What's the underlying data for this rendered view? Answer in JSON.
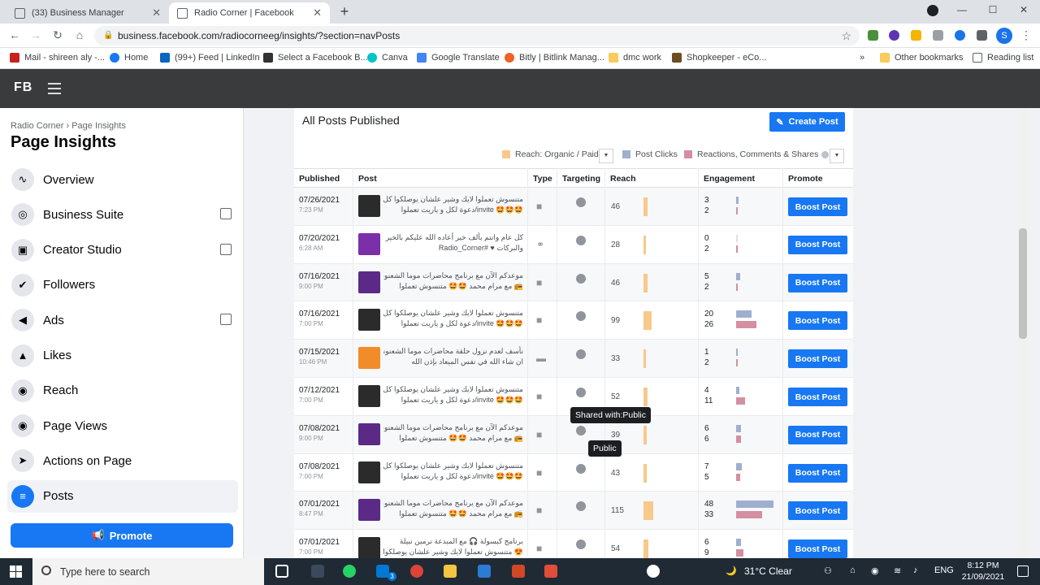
{
  "browser": {
    "tabs": [
      {
        "title": "(33) Business Manager",
        "active": false
      },
      {
        "title": "Radio Corner | Facebook",
        "active": true
      }
    ],
    "url": "business.facebook.com/radiocorneeg/insights/?section=navPosts",
    "bookmarks": [
      "Mail - shireen aly -...",
      "Home",
      "(99+) Feed | LinkedIn",
      "Select a Facebook B...",
      "Canva",
      "Google Translate",
      "Bitly | Bitlink Manag...",
      "dmc work",
      "Shopkeeper - eCo..."
    ],
    "other_bookmarks": "Other bookmarks",
    "reading_list": "Reading list",
    "profile_initial": "S"
  },
  "topbar": {
    "logo": "FB"
  },
  "sidebar": {
    "breadcrumb": "Radio Corner › Page Insights",
    "title": "Page Insights",
    "items": [
      {
        "label": "Overview",
        "icon": "chart-icon",
        "glyph": "∿",
        "external": false,
        "active": false
      },
      {
        "label": "Business Suite",
        "icon": "business-suite-icon",
        "glyph": "◎",
        "external": true,
        "active": false
      },
      {
        "label": "Creator Studio",
        "icon": "creator-studio-icon",
        "glyph": "▣",
        "external": true,
        "active": false
      },
      {
        "label": "Followers",
        "icon": "followers-icon",
        "glyph": "✔",
        "external": false,
        "active": false
      },
      {
        "label": "Ads",
        "icon": "megaphone-icon",
        "glyph": "◀",
        "external": true,
        "active": false
      },
      {
        "label": "Likes",
        "icon": "thumbs-up-icon",
        "glyph": "▲",
        "external": false,
        "active": false
      },
      {
        "label": "Reach",
        "icon": "reach-icon",
        "glyph": "◉",
        "external": false,
        "active": false
      },
      {
        "label": "Page Views",
        "icon": "eye-icon",
        "glyph": "◉",
        "external": false,
        "active": false
      },
      {
        "label": "Actions on Page",
        "icon": "cursor-icon",
        "glyph": "➤",
        "external": false,
        "active": false
      },
      {
        "label": "Posts",
        "icon": "posts-icon",
        "glyph": "≡",
        "external": false,
        "active": true
      }
    ],
    "promote_label": "Promote"
  },
  "main": {
    "title": "All Posts Published",
    "create_post_label": "Create Post",
    "legend": {
      "reach": "Reach: Organic / Paid",
      "clicks": "Post Clicks",
      "reactions": "Reactions, Comments & Shares"
    },
    "columns": [
      "Published",
      "Post",
      "Type",
      "Targeting",
      "Reach",
      "Engagement",
      "Promote"
    ],
    "boost_label": "Boost Post",
    "tooltip_shared": "Shared with:Public",
    "tooltip_public": "Public",
    "rows": [
      {
        "date": "07/26/2021",
        "time": "7:23 PM",
        "line1": "متنسوش تعملوا لايك وشير علشان يوصلكوا كل جديد",
        "line2": "🤩🤩🤩 invite/دعوة لكل و ياريت تعملوا",
        "type": "video",
        "thumb": "#2b2b2b",
        "reach": "46",
        "reach_frac": 0.4,
        "clicks": "3",
        "reactions": "2",
        "clicks_frac": 0.06,
        "reactions_frac": 0.04
      },
      {
        "date": "07/20/2021",
        "time": "6:28 AM",
        "line1": "كل عام وانتم بألف خير أعاده الله عليكم بالخير واليمن",
        "line2": "والبركات ♥ #Radio_Corner",
        "type": "link",
        "thumb": "#7b2fa8",
        "reach": "28",
        "reach_frac": 0.24,
        "clicks": "0",
        "reactions": "2",
        "clicks_frac": 0.0,
        "reactions_frac": 0.04
      },
      {
        "date": "07/16/2021",
        "time": "9:00 PM",
        "line1": "موعدكم الآن مع برنامج محاضرات موما الشعنونة",
        "line2": "📻 مع مرام محمد 🤩🤩 متنسوش تعملوا",
        "type": "video",
        "thumb": "#5b2a86",
        "reach": "46",
        "reach_frac": 0.4,
        "clicks": "5",
        "reactions": "2",
        "clicks_frac": 0.1,
        "reactions_frac": 0.04
      },
      {
        "date": "07/16/2021",
        "time": "7:00 PM",
        "line1": "متنسوش تعملوا لايك وشير علشان يوصلكوا كل جديد",
        "line2": "🤩🤩🤩 invite/دعوة لكل و ياريت تعملوا",
        "type": "video",
        "thumb": "#2b2b2b",
        "reach": "99",
        "reach_frac": 0.86,
        "clicks": "20",
        "reactions": "26",
        "clicks_frac": 0.42,
        "reactions_frac": 0.54
      },
      {
        "date": "07/15/2021",
        "time": "10:46 PM",
        "line1": "نأسف لعدم نزول حلقة محاضرات موما الشعنونة علي",
        "line2": "ان شاء الله في نفس الميعاد بإذن الله",
        "type": "status",
        "thumb": "#f28c28",
        "reach": "33",
        "reach_frac": 0.29,
        "clicks": "1",
        "reactions": "2",
        "clicks_frac": 0.02,
        "reactions_frac": 0.04
      },
      {
        "date": "07/12/2021",
        "time": "7:00 PM",
        "line1": "متنسوش تعملوا لايك وشير علشان يوصلكوا كل جديد",
        "line2": "🤩🤩🤩 invite/دعوة لكل و ياريت تعملوا",
        "type": "video",
        "thumb": "#2b2b2b",
        "reach": "52",
        "reach_frac": 0.45,
        "clicks": "4",
        "reactions": "11",
        "clicks_frac": 0.08,
        "reactions_frac": 0.23
      },
      {
        "date": "07/08/2021",
        "time": "9:00 PM",
        "line1": "موعدكم الآن مع برنامج محاضرات موما الشعنونة",
        "line2": "📻 مع مرام محمد 🤩🤩 متنسوش تعملوا",
        "type": "video",
        "thumb": "#5b2a86",
        "reach": "39",
        "reach_frac": 0.34,
        "clicks": "6",
        "reactions": "6",
        "clicks_frac": 0.12,
        "reactions_frac": 0.12
      },
      {
        "date": "07/08/2021",
        "time": "7:00 PM",
        "line1": "متنسوش تعملوا لايك وشير علشان يوصلكوا كل جديد",
        "line2": "🤩🤩🤩 invite/دعوة لكل و ياريت تعملوا",
        "type": "video",
        "thumb": "#2b2b2b",
        "reach": "43",
        "reach_frac": 0.37,
        "clicks": "7",
        "reactions": "5",
        "clicks_frac": 0.15,
        "reactions_frac": 0.1
      },
      {
        "date": "07/01/2021",
        "time": "8:47 PM",
        "line1": "موعدكم الآن مع برنامج محاضرات موما الشعنونة",
        "line2": "📻 مع مرام محمد 🤩🤩 متنسوش تعملوا",
        "type": "video",
        "thumb": "#5b2a86",
        "reach": "115",
        "reach_frac": 1.0,
        "clicks": "48",
        "reactions": "33",
        "clicks_frac": 1.0,
        "reactions_frac": 0.69
      },
      {
        "date": "07/01/2021",
        "time": "7:00 PM",
        "line1": "برنامج كبسولة 🎧 مع المبدعة نرمين نبيلة",
        "line2": "😍 متنسوش تعملوا لايك وشير علشان يوصلكوا كل",
        "type": "video",
        "thumb": "#2b2b2b",
        "reach": "54",
        "reach_frac": 0.47,
        "clicks": "6",
        "reactions": "9",
        "clicks_frac": 0.12,
        "reactions_frac": 0.19
      }
    ]
  },
  "taskbar": {
    "search_placeholder": "Type here to search",
    "weather": "31°C  Clear",
    "lang": "ENG",
    "time": "8:12 PM",
    "date": "21/09/2021",
    "mail_badge": "3"
  }
}
